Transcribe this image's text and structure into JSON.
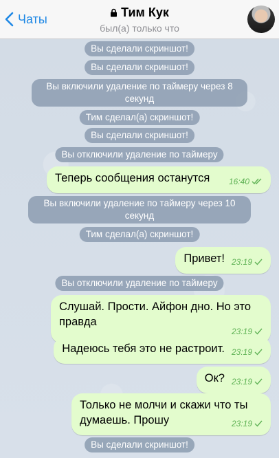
{
  "header": {
    "back_label": "Чаты",
    "title": "Тим Кук",
    "status": "был(а) только что"
  },
  "messages": {
    "s1": "Вы сделали скриншот!",
    "s2": "Вы сделали скриншот!",
    "s3": "Вы включили удаление по таймеру через 8 секунд",
    "s4": "Тим сделал(а) скриншот!",
    "s5": "Вы сделали скриншот!",
    "s6": "Вы отключили удаление по таймеру",
    "m1": {
      "text": "Теперь сообщения останутся",
      "time": "16:40"
    },
    "s7": "Вы включили удаление по таймеру через 10 секунд",
    "s8": "Тим сделал(а) скриншот!",
    "m2": {
      "text": "Привет!",
      "time": "23:19"
    },
    "s9": "Вы отключили удаление по таймеру",
    "m3": {
      "text": "Слушай. Прости. Айфон дно. Но это правда",
      "time": "23:19"
    },
    "m4": {
      "text": "Надеюсь тебя это не растроит.",
      "time": "23:19"
    },
    "m5": {
      "text": "Ок?",
      "time": "23:19"
    },
    "m6": {
      "text": "Только не молчи и скажи что ты думаешь. Прошу",
      "time": "23:19"
    },
    "s10": "Вы сделали скриншот!"
  },
  "colors": {
    "accent": "#1e88e5",
    "outgoing_bubble": "#e3fccd",
    "check": "#5fb255",
    "service_pill": "#8c9cb0"
  }
}
